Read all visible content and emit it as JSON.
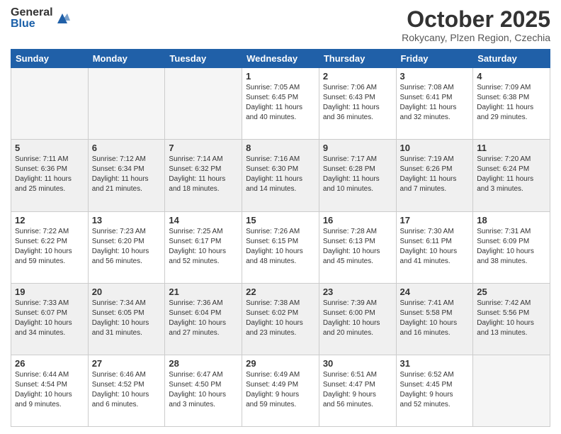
{
  "logo": {
    "general": "General",
    "blue": "Blue"
  },
  "header": {
    "title": "October 2025",
    "subtitle": "Rokycany, Plzen Region, Czechia"
  },
  "weekdays": [
    "Sunday",
    "Monday",
    "Tuesday",
    "Wednesday",
    "Thursday",
    "Friday",
    "Saturday"
  ],
  "weeks": [
    [
      {
        "day": "",
        "text": ""
      },
      {
        "day": "",
        "text": ""
      },
      {
        "day": "",
        "text": ""
      },
      {
        "day": "1",
        "text": "Sunrise: 7:05 AM\nSunset: 6:45 PM\nDaylight: 11 hours\nand 40 minutes."
      },
      {
        "day": "2",
        "text": "Sunrise: 7:06 AM\nSunset: 6:43 PM\nDaylight: 11 hours\nand 36 minutes."
      },
      {
        "day": "3",
        "text": "Sunrise: 7:08 AM\nSunset: 6:41 PM\nDaylight: 11 hours\nand 32 minutes."
      },
      {
        "day": "4",
        "text": "Sunrise: 7:09 AM\nSunset: 6:38 PM\nDaylight: 11 hours\nand 29 minutes."
      }
    ],
    [
      {
        "day": "5",
        "text": "Sunrise: 7:11 AM\nSunset: 6:36 PM\nDaylight: 11 hours\nand 25 minutes."
      },
      {
        "day": "6",
        "text": "Sunrise: 7:12 AM\nSunset: 6:34 PM\nDaylight: 11 hours\nand 21 minutes."
      },
      {
        "day": "7",
        "text": "Sunrise: 7:14 AM\nSunset: 6:32 PM\nDaylight: 11 hours\nand 18 minutes."
      },
      {
        "day": "8",
        "text": "Sunrise: 7:16 AM\nSunset: 6:30 PM\nDaylight: 11 hours\nand 14 minutes."
      },
      {
        "day": "9",
        "text": "Sunrise: 7:17 AM\nSunset: 6:28 PM\nDaylight: 11 hours\nand 10 minutes."
      },
      {
        "day": "10",
        "text": "Sunrise: 7:19 AM\nSunset: 6:26 PM\nDaylight: 11 hours\nand 7 minutes."
      },
      {
        "day": "11",
        "text": "Sunrise: 7:20 AM\nSunset: 6:24 PM\nDaylight: 11 hours\nand 3 minutes."
      }
    ],
    [
      {
        "day": "12",
        "text": "Sunrise: 7:22 AM\nSunset: 6:22 PM\nDaylight: 10 hours\nand 59 minutes."
      },
      {
        "day": "13",
        "text": "Sunrise: 7:23 AM\nSunset: 6:20 PM\nDaylight: 10 hours\nand 56 minutes."
      },
      {
        "day": "14",
        "text": "Sunrise: 7:25 AM\nSunset: 6:17 PM\nDaylight: 10 hours\nand 52 minutes."
      },
      {
        "day": "15",
        "text": "Sunrise: 7:26 AM\nSunset: 6:15 PM\nDaylight: 10 hours\nand 48 minutes."
      },
      {
        "day": "16",
        "text": "Sunrise: 7:28 AM\nSunset: 6:13 PM\nDaylight: 10 hours\nand 45 minutes."
      },
      {
        "day": "17",
        "text": "Sunrise: 7:30 AM\nSunset: 6:11 PM\nDaylight: 10 hours\nand 41 minutes."
      },
      {
        "day": "18",
        "text": "Sunrise: 7:31 AM\nSunset: 6:09 PM\nDaylight: 10 hours\nand 38 minutes."
      }
    ],
    [
      {
        "day": "19",
        "text": "Sunrise: 7:33 AM\nSunset: 6:07 PM\nDaylight: 10 hours\nand 34 minutes."
      },
      {
        "day": "20",
        "text": "Sunrise: 7:34 AM\nSunset: 6:05 PM\nDaylight: 10 hours\nand 31 minutes."
      },
      {
        "day": "21",
        "text": "Sunrise: 7:36 AM\nSunset: 6:04 PM\nDaylight: 10 hours\nand 27 minutes."
      },
      {
        "day": "22",
        "text": "Sunrise: 7:38 AM\nSunset: 6:02 PM\nDaylight: 10 hours\nand 23 minutes."
      },
      {
        "day": "23",
        "text": "Sunrise: 7:39 AM\nSunset: 6:00 PM\nDaylight: 10 hours\nand 20 minutes."
      },
      {
        "day": "24",
        "text": "Sunrise: 7:41 AM\nSunset: 5:58 PM\nDaylight: 10 hours\nand 16 minutes."
      },
      {
        "day": "25",
        "text": "Sunrise: 7:42 AM\nSunset: 5:56 PM\nDaylight: 10 hours\nand 13 minutes."
      }
    ],
    [
      {
        "day": "26",
        "text": "Sunrise: 6:44 AM\nSunset: 4:54 PM\nDaylight: 10 hours\nand 9 minutes."
      },
      {
        "day": "27",
        "text": "Sunrise: 6:46 AM\nSunset: 4:52 PM\nDaylight: 10 hours\nand 6 minutes."
      },
      {
        "day": "28",
        "text": "Sunrise: 6:47 AM\nSunset: 4:50 PM\nDaylight: 10 hours\nand 3 minutes."
      },
      {
        "day": "29",
        "text": "Sunrise: 6:49 AM\nSunset: 4:49 PM\nDaylight: 9 hours\nand 59 minutes."
      },
      {
        "day": "30",
        "text": "Sunrise: 6:51 AM\nSunset: 4:47 PM\nDaylight: 9 hours\nand 56 minutes."
      },
      {
        "day": "31",
        "text": "Sunrise: 6:52 AM\nSunset: 4:45 PM\nDaylight: 9 hours\nand 52 minutes."
      },
      {
        "day": "",
        "text": ""
      }
    ]
  ]
}
